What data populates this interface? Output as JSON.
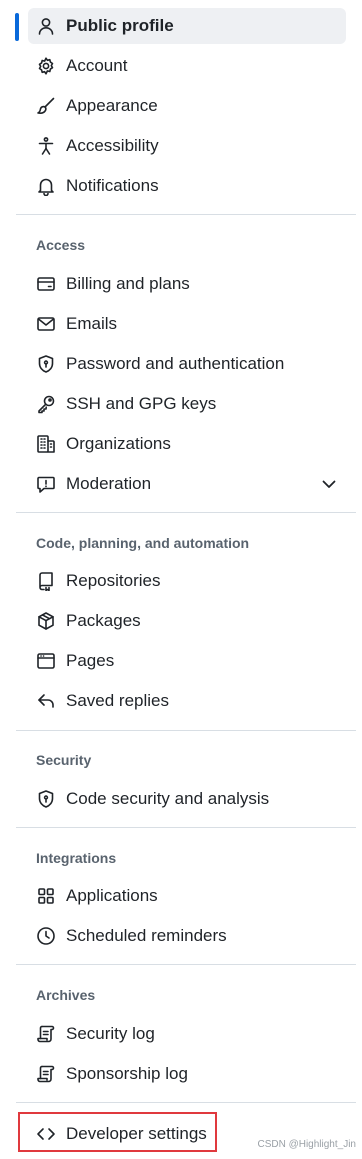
{
  "nav": {
    "top_items": [
      {
        "label": "Public profile",
        "icon": "person-icon",
        "active": true
      },
      {
        "label": "Account",
        "icon": "gear-icon"
      },
      {
        "label": "Appearance",
        "icon": "paintbrush-icon"
      },
      {
        "label": "Accessibility",
        "icon": "accessibility-icon"
      },
      {
        "label": "Notifications",
        "icon": "bell-icon"
      }
    ],
    "sections": [
      {
        "heading": "Access",
        "items": [
          {
            "label": "Billing and plans",
            "icon": "credit-card-icon"
          },
          {
            "label": "Emails",
            "icon": "mail-icon"
          },
          {
            "label": "Password and authentication",
            "icon": "shield-lock-icon"
          },
          {
            "label": "SSH and GPG keys",
            "icon": "key-icon"
          },
          {
            "label": "Organizations",
            "icon": "organization-icon"
          },
          {
            "label": "Moderation",
            "icon": "report-icon",
            "expandable": true
          }
        ]
      },
      {
        "heading": "Code, planning, and automation",
        "items": [
          {
            "label": "Repositories",
            "icon": "repo-icon"
          },
          {
            "label": "Packages",
            "icon": "package-icon"
          },
          {
            "label": "Pages",
            "icon": "browser-icon"
          },
          {
            "label": "Saved replies",
            "icon": "reply-icon"
          }
        ]
      },
      {
        "heading": "Security",
        "items": [
          {
            "label": "Code security and analysis",
            "icon": "shield-lock-icon"
          }
        ]
      },
      {
        "heading": "Integrations",
        "items": [
          {
            "label": "Applications",
            "icon": "apps-icon"
          },
          {
            "label": "Scheduled reminders",
            "icon": "clock-icon"
          }
        ]
      },
      {
        "heading": "Archives",
        "items": [
          {
            "label": "Security log",
            "icon": "log-icon"
          },
          {
            "label": "Sponsorship log",
            "icon": "log-icon"
          }
        ]
      }
    ],
    "bottom_items": [
      {
        "label": "Developer settings",
        "icon": "code-icon",
        "highlighted": true
      }
    ]
  },
  "colors": {
    "active_bar": "#0969da",
    "active_bg": "#eef0f3",
    "highlight_border": "#e0393e",
    "heading": "#59636e",
    "divider": "#d8dee4"
  },
  "watermark": "CSDN @Highlight_Jin"
}
